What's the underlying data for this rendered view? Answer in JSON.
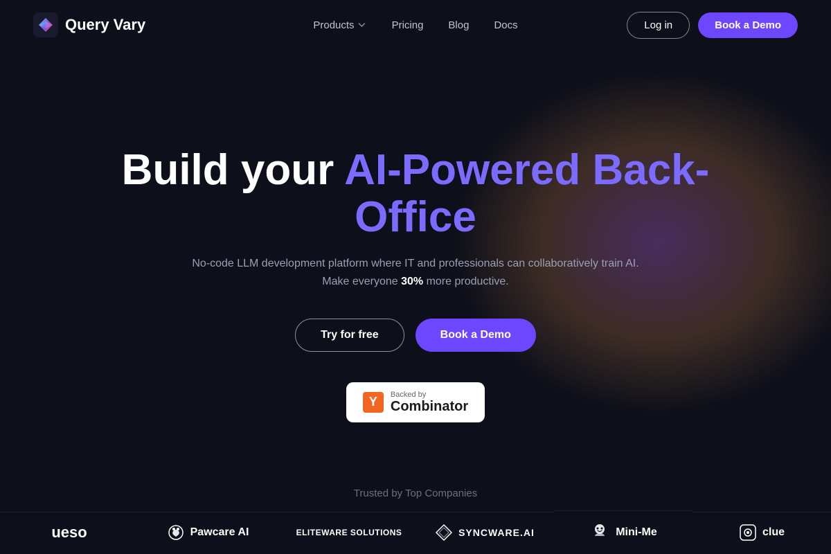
{
  "brand": {
    "name": "Query Vary",
    "logo_alt": "Query Vary logo"
  },
  "nav": {
    "products_label": "Products",
    "pricing_label": "Pricing",
    "blog_label": "Blog",
    "docs_label": "Docs",
    "login_label": "Log in",
    "book_demo_label": "Book a Demo"
  },
  "hero": {
    "title_part1": "Build your ",
    "title_accent": "AI-Powered Back-Office",
    "subtitle": "No-code LLM development platform where IT and professionals can collaboratively train AI. Make everyone ",
    "subtitle_bold": "30%",
    "subtitle_end": " more productive.",
    "try_free_label": "Try for free",
    "book_demo_label": "Book a Demo"
  },
  "yc": {
    "backed_by": "Backed by",
    "y_letter": "Y",
    "combinator_label": "Combinator"
  },
  "trusted": {
    "label": "Trusted by Top Companies",
    "logos": [
      {
        "name": "ueso",
        "display": "ueso",
        "prefix": ""
      },
      {
        "name": "pawcare-ai",
        "display": "Pawcare AI",
        "prefix": "🐾"
      },
      {
        "name": "eliteware",
        "display": "ELITEWARE SOLUTIONS",
        "prefix": "◈"
      },
      {
        "name": "syncware",
        "display": "SYNCWARE.AI",
        "prefix": "◇"
      },
      {
        "name": "mini-me",
        "display": "Mini-Me",
        "prefix": "🤖"
      },
      {
        "name": "clue",
        "display": "clue",
        "prefix": "🔍"
      }
    ]
  }
}
